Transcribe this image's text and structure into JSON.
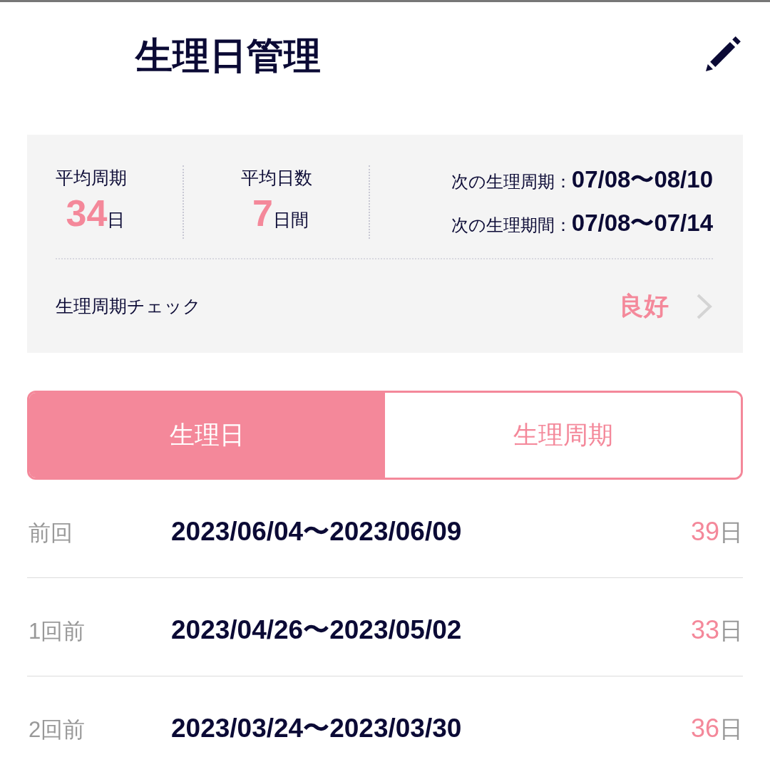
{
  "header": {
    "title": "生理日管理"
  },
  "summary": {
    "stats": [
      {
        "label": "平均周期",
        "value": "34",
        "unit": "日"
      },
      {
        "label": "平均日数",
        "value": "7",
        "unit": "日間"
      }
    ],
    "forecasts": [
      {
        "label": "次の生理周期：",
        "dates": "07/08〜08/10"
      },
      {
        "label": "次の生理期間：",
        "dates": "07/08〜07/14"
      }
    ],
    "check": {
      "label": "生理周期チェック",
      "result": "良好"
    }
  },
  "tabs": [
    {
      "label": "生理日",
      "selected": true
    },
    {
      "label": "生理周期",
      "selected": false
    }
  ],
  "history": [
    {
      "label": "前回",
      "range": "2023/06/04〜2023/06/09",
      "days": "39",
      "unit": "日"
    },
    {
      "label": "1回前",
      "range": "2023/04/26〜2023/05/02",
      "days": "33",
      "unit": "日"
    },
    {
      "label": "2回前",
      "range": "2023/03/24〜2023/03/30",
      "days": "36",
      "unit": "日"
    }
  ]
}
